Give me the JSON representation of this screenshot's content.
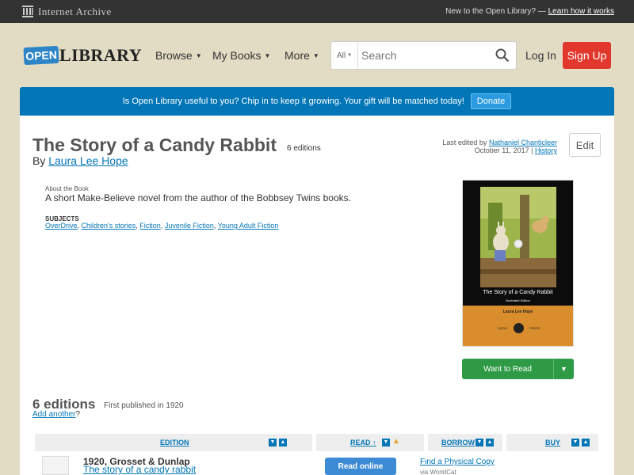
{
  "ia_bar": {
    "brand": "Internet Archive",
    "new_text": "New to the Open Library? —",
    "learn_link": "Learn how it works"
  },
  "header": {
    "logo_open": "OPEN",
    "logo_library": "LIBRARY",
    "nav": [
      {
        "label": "Browse"
      },
      {
        "label": "My Books"
      },
      {
        "label": "More"
      }
    ],
    "search": {
      "scope": "All",
      "placeholder": "Search"
    },
    "login": "Log In",
    "signup": "Sign Up"
  },
  "donate": {
    "text": "Is Open Library useful to you? Chip in to keep it growing. Your gift will be matched today!",
    "button": "Donate"
  },
  "work": {
    "title": "The Story of a Candy Rabbit",
    "editions_badge": "6 editions",
    "by": "By",
    "author": "Laura Lee Hope",
    "last_edited_label": "Last edited by",
    "last_edited_by": "Nathaniel Chanticleer",
    "last_edited_date": "October 11, 2017 |",
    "history_link": "History",
    "edit_button": "Edit",
    "about_label": "About the Book",
    "about_text": "A short Make-Believe novel from the author of the Bobbsey Twins books.",
    "subjects_label": "SUBJECTS",
    "subjects": [
      "OverDrive",
      "Children's stories",
      "Fiction",
      "Juvenile Fiction",
      "Young Adult Fiction"
    ]
  },
  "cover": {
    "title": "The Story of a Candy Rabbit",
    "subtitle": "Illustrated Edition",
    "author": "Laura Lee Hope",
    "publisher_left": "DODO",
    "publisher_right": "PRESS"
  },
  "want_to_read": {
    "label": "Want to Read"
  },
  "editions_section": {
    "heading": "6 editions",
    "first_published": "First published in 1920",
    "add_another": "Add another",
    "add_suffix": "?",
    "columns": {
      "edition": "EDITION",
      "read": "READ ↑",
      "borrow": "BORROW",
      "buy": "BUY"
    },
    "rows": [
      {
        "publisher": "1920, Grosset & Dunlap",
        "title": "The story of a candy rabbit",
        "read_button": "Read online",
        "borrow_link": "Find a Physical Copy",
        "borrow_via": "via WorldCat"
      }
    ]
  },
  "colors": {
    "accent_blue": "#0376b8",
    "signup_red": "#e1372c",
    "want_green": "#2f9a45",
    "page_bg": "#e2dcc5"
  }
}
